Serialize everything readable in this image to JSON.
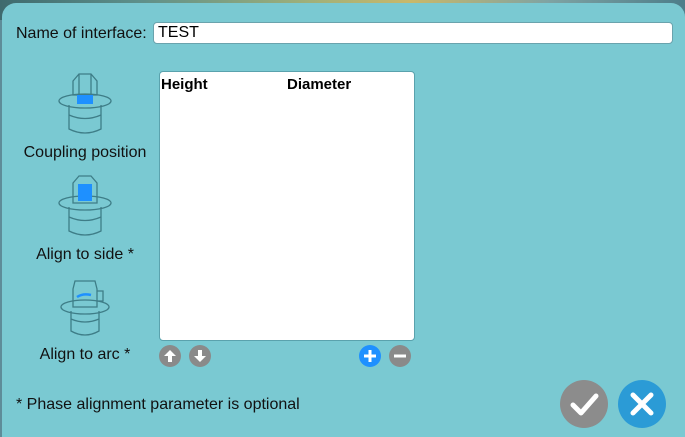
{
  "dialog": {
    "name_label": "Name of interface:",
    "name_value": "TEST",
    "options": [
      {
        "label": "Coupling position"
      },
      {
        "label": "Align to side *"
      },
      {
        "label": "Align to arc *"
      }
    ],
    "table": {
      "columns": [
        "Height",
        "Diameter"
      ],
      "rows": []
    },
    "footnote": "* Phase alignment parameter is optional",
    "colors": {
      "background": "#7ac9d2",
      "accent_blue": "#1e90ff",
      "button_gray": "#888888",
      "close_blue": "#2b9bd6"
    },
    "icons": {
      "move_up": "arrow-up-icon",
      "move_down": "arrow-down-icon",
      "add": "plus-icon",
      "remove": "minus-icon",
      "ok": "checkmark-icon",
      "cancel": "close-icon"
    }
  }
}
